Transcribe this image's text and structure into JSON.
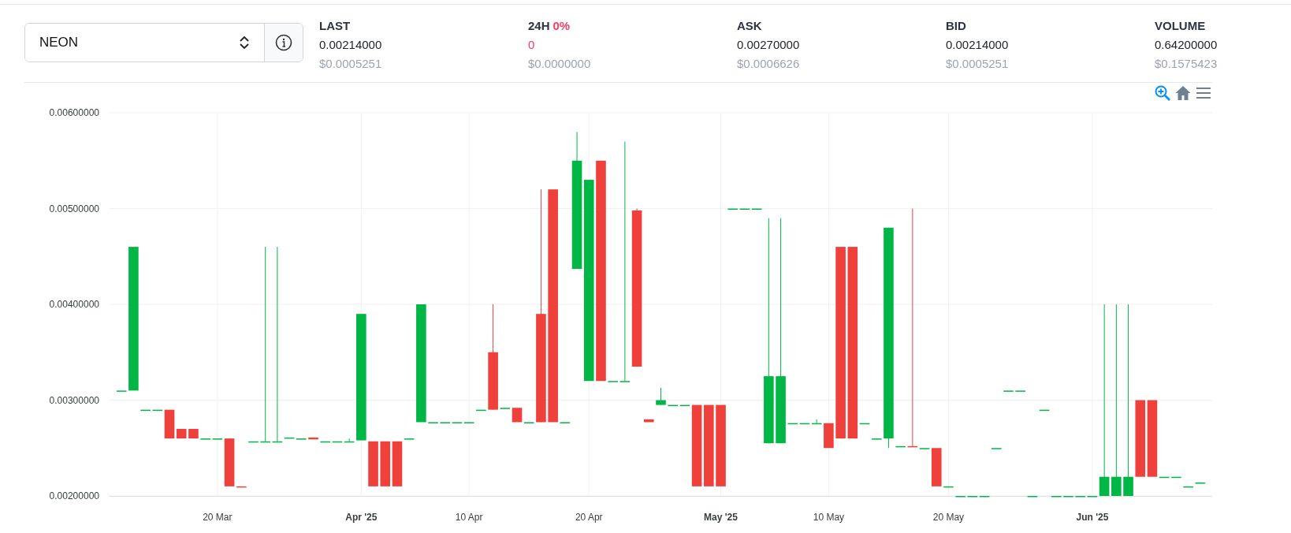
{
  "pair_select": {
    "value": "NEON"
  },
  "stats": [
    {
      "label": "LAST",
      "value": "0.00214000",
      "usd": "$0.0005251",
      "negative": false
    },
    {
      "label": "24H",
      "change": "0%",
      "value": "0",
      "usd": "$0.0000000",
      "negative": true
    },
    {
      "label": "ASK",
      "value": "0.00270000",
      "usd": "$0.0006626",
      "negative": false
    },
    {
      "label": "BID",
      "value": "0.00214000",
      "usd": "$0.0005251",
      "negative": false
    },
    {
      "label": "VOLUME",
      "value": "0.64200000",
      "usd": "$0.1575423",
      "negative": false
    }
  ],
  "chart": {
    "chart_data": {
      "type": "candlestick",
      "x": [
        "2025-03-12",
        "2025-03-13",
        "2025-03-14",
        "2025-03-15",
        "2025-03-16",
        "2025-03-17",
        "2025-03-18",
        "2025-03-19",
        "2025-03-20",
        "2025-03-21",
        "2025-03-22",
        "2025-03-23",
        "2025-03-24",
        "2025-03-25",
        "2025-03-26",
        "2025-03-27",
        "2025-03-28",
        "2025-03-29",
        "2025-03-30",
        "2025-03-31",
        "2025-04-01",
        "2025-04-02",
        "2025-04-03",
        "2025-04-04",
        "2025-04-05",
        "2025-04-06",
        "2025-04-07",
        "2025-04-08",
        "2025-04-09",
        "2025-04-10",
        "2025-04-11",
        "2025-04-12",
        "2025-04-13",
        "2025-04-14",
        "2025-04-15",
        "2025-04-16",
        "2025-04-17",
        "2025-04-18",
        "2025-04-19",
        "2025-04-20",
        "2025-04-21",
        "2025-04-22",
        "2025-04-23",
        "2025-04-24",
        "2025-04-25",
        "2025-04-26",
        "2025-04-27",
        "2025-04-28",
        "2025-04-29",
        "2025-04-30",
        "2025-05-01",
        "2025-05-02",
        "2025-05-03",
        "2025-05-04",
        "2025-05-05",
        "2025-05-06",
        "2025-05-07",
        "2025-05-08",
        "2025-05-09",
        "2025-05-10",
        "2025-05-11",
        "2025-05-12",
        "2025-05-13",
        "2025-05-14",
        "2025-05-15",
        "2025-05-16",
        "2025-05-17",
        "2025-05-18",
        "2025-05-19",
        "2025-05-20",
        "2025-05-21",
        "2025-05-22",
        "2025-05-23",
        "2025-05-24",
        "2025-05-25",
        "2025-05-26",
        "2025-05-27",
        "2025-05-28",
        "2025-05-29",
        "2025-05-30",
        "2025-05-31",
        "2025-06-01",
        "2025-06-02",
        "2025-06-03",
        "2025-06-04",
        "2025-06-05",
        "2025-06-06",
        "2025-06-07",
        "2025-06-08",
        "2025-06-09",
        "2025-06-10"
      ],
      "ohlc": [
        [
          0.0031,
          0.0031,
          0.0031,
          0.0031
        ],
        [
          0.0031,
          0.0046,
          0.0031,
          0.0046
        ],
        [
          0.0029,
          0.0029,
          0.0029,
          0.0029
        ],
        [
          0.0029,
          0.0029,
          0.0029,
          0.0029
        ],
        [
          0.0029,
          0.0029,
          0.0026,
          0.0026
        ],
        [
          0.0027,
          0.0027,
          0.0026,
          0.0026
        ],
        [
          0.0027,
          0.0027,
          0.0026,
          0.0026
        ],
        [
          0.0026,
          0.0026,
          0.0026,
          0.0026
        ],
        [
          0.0026,
          0.0026,
          0.0026,
          0.0026
        ],
        [
          0.0026,
          0.0026,
          0.0021,
          0.0021
        ],
        [
          0.0021,
          0.0021,
          0.00209,
          0.00209
        ],
        [
          0.00257,
          0.00257,
          0.00257,
          0.00257
        ],
        [
          0.00257,
          0.0046,
          0.00257,
          0.00257
        ],
        [
          0.00257,
          0.0046,
          0.00257,
          0.00257
        ],
        [
          0.00261,
          0.00261,
          0.00261,
          0.00261
        ],
        [
          0.0026,
          0.0026,
          0.0026,
          0.0026
        ],
        [
          0.00261,
          0.00261,
          0.00259,
          0.00259
        ],
        [
          0.00257,
          0.00257,
          0.00257,
          0.00257
        ],
        [
          0.00257,
          0.00257,
          0.00257,
          0.00257
        ],
        [
          0.00257,
          0.0026,
          0.00257,
          0.00257
        ],
        [
          0.00258,
          0.0039,
          0.00258,
          0.0039
        ],
        [
          0.00257,
          0.00257,
          0.0021,
          0.0021
        ],
        [
          0.00257,
          0.00257,
          0.0021,
          0.0021
        ],
        [
          0.00257,
          0.00257,
          0.0021,
          0.0021
        ],
        [
          0.0026,
          0.0026,
          0.0026,
          0.0026
        ],
        [
          0.00277,
          0.004,
          0.00277,
          0.004
        ],
        [
          0.00277,
          0.00277,
          0.00277,
          0.00277
        ],
        [
          0.00277,
          0.00277,
          0.00277,
          0.00277
        ],
        [
          0.00277,
          0.00277,
          0.00277,
          0.00277
        ],
        [
          0.00277,
          0.00277,
          0.00277,
          0.00277
        ],
        [
          0.0029,
          0.0029,
          0.0029,
          0.0029
        ],
        [
          0.0035,
          0.004,
          0.0029,
          0.0029
        ],
        [
          0.00292,
          0.00292,
          0.00292,
          0.00292
        ],
        [
          0.00292,
          0.00292,
          0.00277,
          0.00277
        ],
        [
          0.00277,
          0.00277,
          0.00277,
          0.00277
        ],
        [
          0.0039,
          0.0052,
          0.00277,
          0.00277
        ],
        [
          0.0052,
          0.0052,
          0.00277,
          0.00277
        ],
        [
          0.00277,
          0.00277,
          0.00277,
          0.00277
        ],
        [
          0.00437,
          0.0058,
          0.00437,
          0.0055
        ],
        [
          0.0032,
          0.0053,
          0.0032,
          0.0053
        ],
        [
          0.0055,
          0.0055,
          0.0032,
          0.0032
        ],
        [
          0.0032,
          0.0032,
          0.0032,
          0.0032
        ],
        [
          0.0032,
          0.0057,
          0.0032,
          0.0032
        ],
        [
          0.00498,
          0.005,
          0.00335,
          0.00335
        ],
        [
          0.0028,
          0.0028,
          0.00277,
          0.00277
        ],
        [
          0.00295,
          0.00313,
          0.00295,
          0.003
        ],
        [
          0.00295,
          0.00295,
          0.00295,
          0.00295
        ],
        [
          0.00295,
          0.00295,
          0.00295,
          0.00295
        ],
        [
          0.00295,
          0.00295,
          0.0021,
          0.0021
        ],
        [
          0.00295,
          0.00295,
          0.0021,
          0.0021
        ],
        [
          0.00295,
          0.00295,
          0.0021,
          0.0021
        ],
        [
          0.005,
          0.005,
          0.005,
          0.005
        ],
        [
          0.005,
          0.005,
          0.005,
          0.005
        ],
        [
          0.005,
          0.005,
          0.005,
          0.005
        ],
        [
          0.00255,
          0.0049,
          0.00255,
          0.00325
        ],
        [
          0.00255,
          0.0049,
          0.00255,
          0.00325
        ],
        [
          0.00276,
          0.00276,
          0.00276,
          0.00276
        ],
        [
          0.00276,
          0.00276,
          0.00276,
          0.00276
        ],
        [
          0.00276,
          0.0028,
          0.00276,
          0.00276
        ],
        [
          0.00276,
          0.00276,
          0.0025,
          0.0025
        ],
        [
          0.0046,
          0.0046,
          0.0026,
          0.0026
        ],
        [
          0.0046,
          0.0046,
          0.0026,
          0.0026
        ],
        [
          0.00276,
          0.00276,
          0.00276,
          0.00276
        ],
        [
          0.0026,
          0.0026,
          0.0026,
          0.0026
        ],
        [
          0.0026,
          0.0048,
          0.0025,
          0.0048
        ],
        [
          0.00252,
          0.00252,
          0.00252,
          0.00252
        ],
        [
          0.00252,
          0.005,
          0.00251,
          0.00251
        ],
        [
          0.0025,
          0.0025,
          0.0025,
          0.0025
        ],
        [
          0.0025,
          0.0025,
          0.0021,
          0.0021
        ],
        [
          0.0021,
          0.0021,
          0.0021,
          0.0021
        ],
        [
          0.002,
          0.002,
          0.002,
          0.002
        ],
        [
          0.002,
          0.002,
          0.002,
          0.002
        ],
        [
          0.002,
          0.002,
          0.002,
          0.002
        ],
        [
          0.0025,
          0.0025,
          0.0025,
          0.0025
        ],
        [
          0.0031,
          0.0031,
          0.0031,
          0.0031
        ],
        [
          0.0031,
          0.0031,
          0.0031,
          0.0031
        ],
        [
          0.002,
          0.002,
          0.002,
          0.002
        ],
        [
          0.0029,
          0.0029,
          0.0029,
          0.0029
        ],
        [
          0.002,
          0.002,
          0.002,
          0.002
        ],
        [
          0.002,
          0.002,
          0.002,
          0.002
        ],
        [
          0.002,
          0.002,
          0.002,
          0.002
        ],
        [
          0.002,
          0.002,
          0.002,
          0.002
        ],
        [
          0.002,
          0.004,
          0.002,
          0.0022
        ],
        [
          0.002,
          0.004,
          0.002,
          0.0022
        ],
        [
          0.002,
          0.004,
          0.002,
          0.0022
        ],
        [
          0.003,
          0.003,
          0.0022,
          0.0022
        ],
        [
          0.003,
          0.003,
          0.0022,
          0.0022
        ],
        [
          0.0022,
          0.0022,
          0.0022,
          0.0022
        ],
        [
          0.0022,
          0.0022,
          0.0022,
          0.0022
        ],
        [
          0.0021,
          0.0021,
          0.0021,
          0.0021
        ],
        [
          0.00214,
          0.00214,
          0.00214,
          0.00214
        ]
      ],
      "xlim": [
        "2025-03-11",
        "2025-06-11"
      ],
      "ylim": [
        0.002,
        0.006
      ],
      "grid": true,
      "yticks": [
        {
          "value": 0.002,
          "label": "0.00200000"
        },
        {
          "value": 0.003,
          "label": "0.00300000"
        },
        {
          "value": 0.004,
          "label": "0.00400000"
        },
        {
          "value": 0.005,
          "label": "0.00500000"
        },
        {
          "value": 0.006,
          "label": "0.00600000"
        }
      ],
      "xticks": [
        {
          "value": "2025-03-20",
          "label": "20 Mar"
        },
        {
          "value": "2025-04-01",
          "label": "Apr '25"
        },
        {
          "value": "2025-04-10",
          "label": "10 Apr"
        },
        {
          "value": "2025-04-20",
          "label": "20 Apr"
        },
        {
          "value": "2025-05-01",
          "label": "May '25"
        },
        {
          "value": "2025-05-10",
          "label": "10 May"
        },
        {
          "value": "2025-05-20",
          "label": "20 May"
        },
        {
          "value": "2025-06-01",
          "label": "Jun '25"
        }
      ]
    }
  }
}
